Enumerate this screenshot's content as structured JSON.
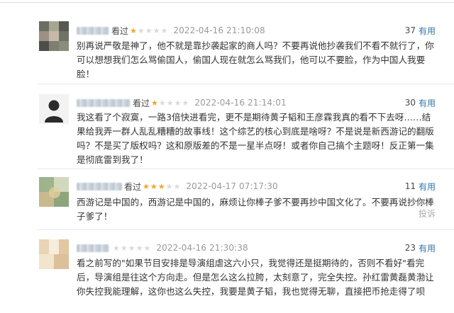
{
  "reviews": [
    {
      "status": "看过",
      "rating": 1,
      "date": "2022-04-16 21:10:08",
      "votes": "37",
      "useful": "有用",
      "content": "别再说严敬是神了，他不就是靠抄袭起家的商人吗？不要再说他抄袭我们不看不就行了，你可以想想我们怎么骂偷国人，偷国人现在就怎么骂我们，他可以不要脸，作为中国人我要脸！"
    },
    {
      "status": "看过",
      "rating": 1,
      "date": "2022-04-16 21:14:01",
      "votes": "30",
      "useful": "有用",
      "content": "我这看了个寂寞，一路3倍快进看完，更不是期待黄子韬和王彦霖我真的看不下去呀……结果给我弄一群人乱乱糟糟的故事线！这个综艺的核心到底是啥呀？不是说是新西游记的翻版吗？不是买了版权吗？这和原版差的不是一星半点呀！或者你自己搞个主题呀！反正第一集是彻底雷到我了！"
    },
    {
      "status": "看过",
      "rating": 3,
      "date": "2022-04-17 07:17:30",
      "votes": "11",
      "useful": "有用",
      "content": "西游记是中国的，西游记是中国的，麻烦让你棒子爹不要再抄中国文化了。不要再说抄你棒子爹了！",
      "report": "投诉"
    },
    {
      "status": "",
      "rating": 0,
      "date": "2022-04-16 21:30:38",
      "votes": "23",
      "useful": "有用",
      "content": "看之前写的\"如果节目安排是导演组虐这六小只，我觉得还是挺期待的，否则不看好\"看完后，导演组是往这个方向走。但是怎么这么拉胯，太刻意了，完全失控。孙红雷黄磊黄渤让你失控我能理解，这你也这么失控，我要是黄子韬，我也觉得无聊，直接把币抢走得了呗"
    }
  ]
}
